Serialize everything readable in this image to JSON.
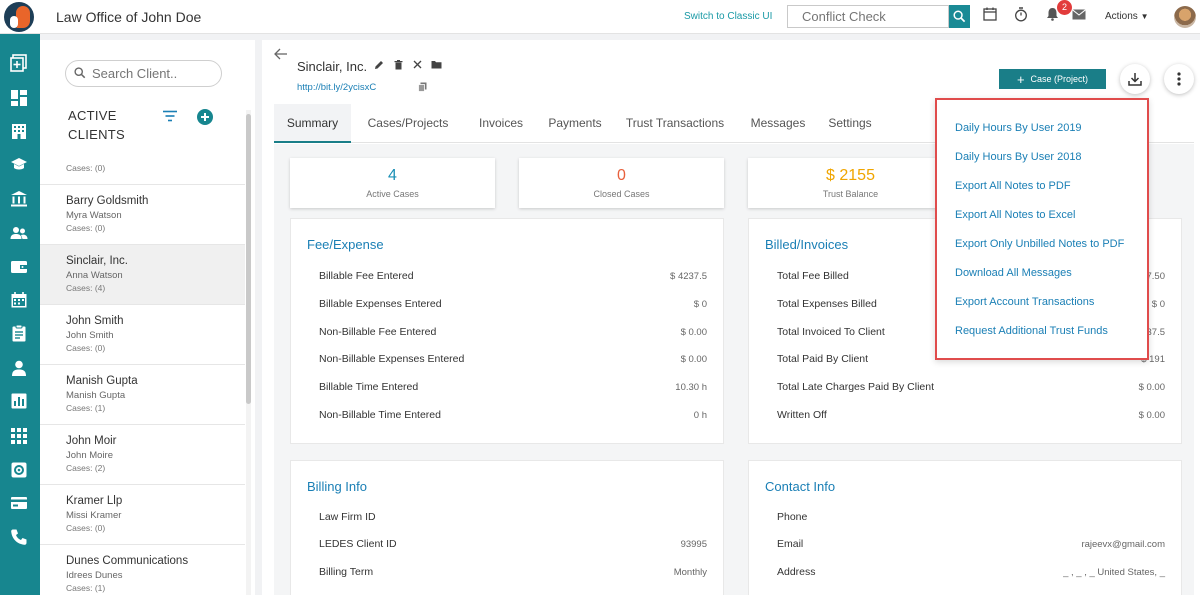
{
  "header": {
    "app_title": "Law Office of John Doe",
    "switch_link": "Switch to Classic UI",
    "conflict_placeholder": "Conflict Check",
    "notification_count": "2",
    "actions_label": "Actions"
  },
  "colors": {
    "teal": "#17868f",
    "link_blue": "#1a7fb5",
    "accent_orange": "#f0a500",
    "closed_red": "#e8603c",
    "highlight_red": "#e04c4c"
  },
  "sidebar_icons": [
    "add-entry-icon",
    "dashboard-icon",
    "building-icon",
    "graduation-cap-icon",
    "bank-icon",
    "users-icon",
    "wallet-icon",
    "calendar-icon",
    "clipboard-icon",
    "person-icon",
    "bar-chart-icon",
    "grid-icon",
    "settings-icon",
    "billing-icon",
    "phone-icon"
  ],
  "client_panel": {
    "search_placeholder": "Search Client..",
    "list_title": "ACTIVE CLIENTS",
    "first_partial_cases": "Cases: (0)",
    "clients": [
      {
        "name": "Barry Goldsmith",
        "contact": "Myra Watson",
        "cases": "Cases: (0)"
      },
      {
        "name": "Sinclair, Inc.",
        "contact": "Anna Watson",
        "cases": "Cases: (4)"
      },
      {
        "name": "John Smith",
        "contact": "John Smith",
        "cases": "Cases: (0)"
      },
      {
        "name": "Manish Gupta",
        "contact": "Manish Gupta",
        "cases": "Cases: (1)"
      },
      {
        "name": "John Moir",
        "contact": "John Moire",
        "cases": "Cases: (2)"
      },
      {
        "name": "Kramer Llp",
        "contact": "Missi Kramer",
        "cases": "Cases: (0)"
      },
      {
        "name": "Dunes Communications",
        "contact": "Idrees Dunes",
        "cases": "Cases: (1)"
      }
    ]
  },
  "main": {
    "client_title": "Sinclair, Inc.",
    "client_link": "http://bit.ly/2ycisxC",
    "case_button": "Case (Project)",
    "tabs": [
      "Summary",
      "Cases/Projects",
      "Invoices",
      "Payments",
      "Trust Transactions",
      "Messages",
      "Settings"
    ],
    "stats": [
      {
        "value": "4",
        "label": "Active Cases"
      },
      {
        "value": "0",
        "label": "Closed Cases"
      },
      {
        "value": "$ 2155",
        "label": "Trust Balance"
      }
    ],
    "fee_expense": {
      "title": "Fee/Expense",
      "rows": [
        {
          "label": "Billable Fee Entered",
          "value": "$ 4237.5"
        },
        {
          "label": "Billable Expenses Entered",
          "value": "$ 0"
        },
        {
          "label": "Non-Billable Fee Entered",
          "value": "$ 0.00"
        },
        {
          "label": "Non-Billable Expenses Entered",
          "value": "$ 0.00"
        },
        {
          "label": "Billable Time Entered",
          "value": "10.30 h"
        },
        {
          "label": "Non-Billable Time Entered",
          "value": "0 h"
        }
      ]
    },
    "billed_invoices": {
      "title": "Billed/Invoices",
      "rows": [
        {
          "label": "Total Fee Billed",
          "value": "7.50"
        },
        {
          "label": "Total Expenses Billed",
          "value": "$ 0"
        },
        {
          "label": "Total Invoiced To Client",
          "value": "37.5"
        },
        {
          "label": "Total Paid By Client",
          "value": "$ 191"
        },
        {
          "label": "Total Late Charges Paid By Client",
          "value": "$ 0.00"
        },
        {
          "label": "Written Off",
          "value": "$ 0.00"
        }
      ]
    },
    "billing_info": {
      "title": "Billing Info",
      "rows": [
        {
          "label": "Law Firm ID",
          "value": ""
        },
        {
          "label": "LEDES Client ID",
          "value": "93995"
        },
        {
          "label": "Billing Term",
          "value": "Monthly"
        }
      ]
    },
    "contact_info": {
      "title": "Contact Info",
      "rows": [
        {
          "label": "Phone",
          "value": ""
        },
        {
          "label": "Email",
          "value": "rajeevx@gmail.com"
        },
        {
          "label": "Address",
          "value": "_ , _ , _ United States, _"
        }
      ]
    }
  },
  "download_menu": {
    "items": [
      "Daily Hours By User 2019",
      "Daily Hours By User 2018",
      "Export All Notes to PDF",
      "Export All Notes to Excel",
      "Export Only Unbilled Notes to PDF",
      "Download All Messages",
      "Export Account Transactions",
      "Request Additional Trust Funds"
    ]
  }
}
